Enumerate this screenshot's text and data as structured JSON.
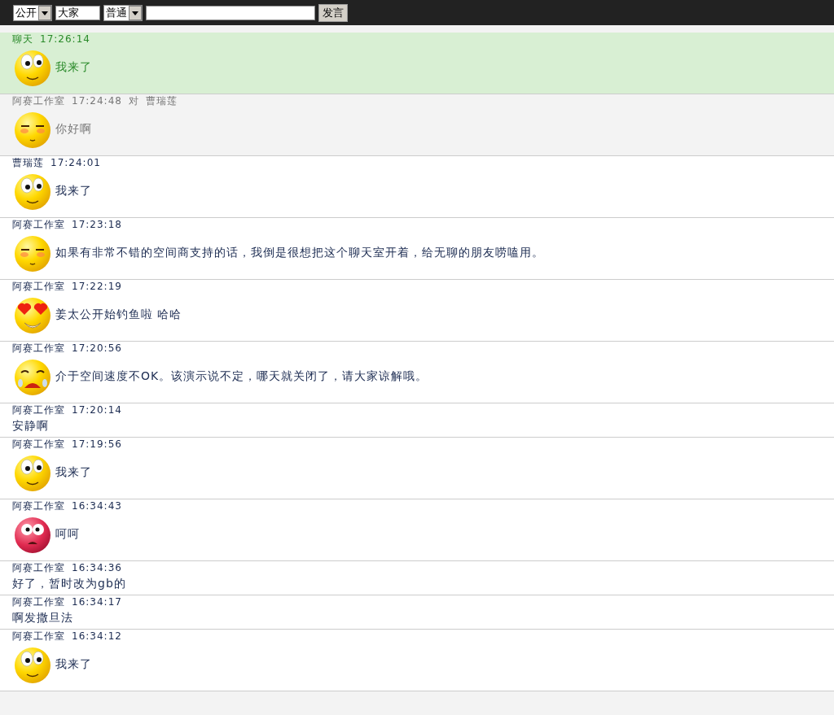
{
  "toolbar": {
    "scope": "公开",
    "target": "大家",
    "style": "普通",
    "send_label": "发言"
  },
  "messages": [
    {
      "kind": "system",
      "sender": "聊天",
      "time": "17:26:14",
      "emoji": {
        "kind": "googly"
      },
      "text": "我来了"
    },
    {
      "kind": "directed",
      "sender": "阿赛工作室",
      "time": "17:24:48",
      "to_word": "对",
      "recipient": "曹瑞莲",
      "emoji": {
        "kind": "shy"
      },
      "text": "你好啊"
    },
    {
      "kind": "normal",
      "sender": "曹瑞莲",
      "time": "17:24:01",
      "emoji": {
        "kind": "googly"
      },
      "text": "我来了"
    },
    {
      "kind": "normal",
      "sender": "阿赛工作室",
      "time": "17:23:18",
      "emoji": {
        "kind": "shy"
      },
      "text": "如果有非常不错的空间商支持的话，我倒是很想把这个聊天室开着，给无聊的朋友唠嗑用。"
    },
    {
      "kind": "normal",
      "sender": "阿赛工作室",
      "time": "17:22:19",
      "emoji": {
        "kind": "love"
      },
      "text": "姜太公开始钓鱼啦 哈哈"
    },
    {
      "kind": "normal",
      "sender": "阿赛工作室",
      "time": "17:20:56",
      "emoji": {
        "kind": "cry"
      },
      "text": "介于空间速度不OK。该演示说不定，哪天就关闭了，请大家谅解哦。"
    },
    {
      "kind": "normal",
      "sender": "阿赛工作室",
      "time": "17:20:14",
      "text": "安静啊"
    },
    {
      "kind": "normal",
      "sender": "阿赛工作室",
      "time": "17:19:56",
      "emoji": {
        "kind": "googly"
      },
      "text": "我来了"
    },
    {
      "kind": "normal",
      "sender": "阿赛工作室",
      "time": "16:34:43",
      "emoji": {
        "kind": "shocked"
      },
      "text": "呵呵"
    },
    {
      "kind": "normal",
      "sender": "阿赛工作室",
      "time": "16:34:36",
      "text": "好了，暂时改为gb的"
    },
    {
      "kind": "normal",
      "sender": "阿赛工作室",
      "time": "16:34:17",
      "text": "啊发撒旦法"
    },
    {
      "kind": "normal",
      "sender": "阿赛工作室",
      "time": "16:34:12",
      "emoji": {
        "kind": "googly"
      },
      "text": "我来了"
    }
  ]
}
